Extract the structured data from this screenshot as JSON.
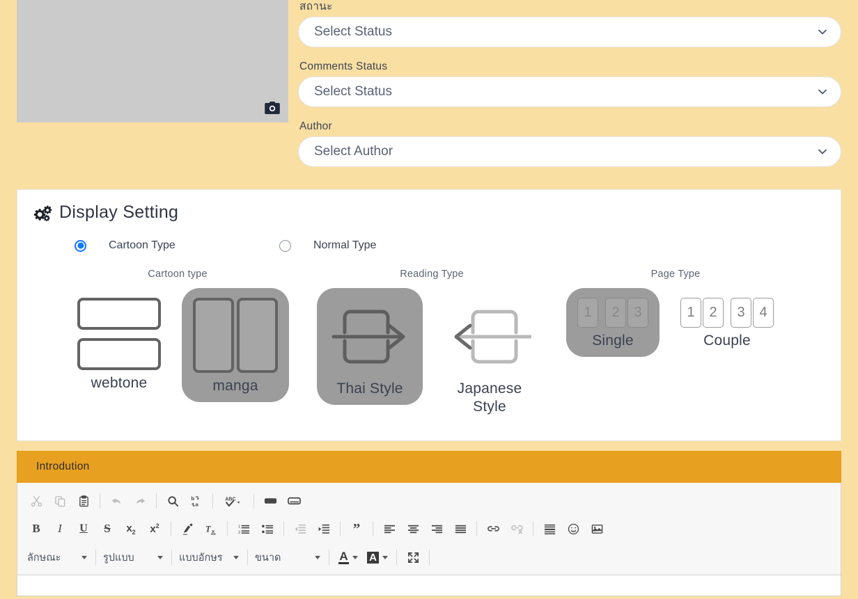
{
  "cover": {
    "camera_icon": "camera-icon",
    "alt": ""
  },
  "form": {
    "fields": [
      {
        "label": "สถานะ",
        "value": "Select Status",
        "name": "status"
      },
      {
        "label": "Comments Status",
        "value": "Select Status",
        "name": "comments-status"
      },
      {
        "label": "Author",
        "value": "Select Author",
        "name": "author"
      }
    ]
  },
  "display_setting": {
    "title": "Display Setting",
    "icon": "cogs-icon",
    "type_radios": [
      {
        "label": "Cartoon Type",
        "selected": true
      },
      {
        "label": "Normal Type",
        "selected": false
      }
    ],
    "groups": [
      {
        "title": "Cartoon type",
        "name": "cartoon-type",
        "options": [
          {
            "label": "webtone",
            "selected": false
          },
          {
            "label": "manga",
            "selected": true
          }
        ]
      },
      {
        "title": "Reading Type",
        "name": "reading-type",
        "options": [
          {
            "label": "Thai Style",
            "selected": true
          },
          {
            "label": "Japanese Style",
            "selected": false
          }
        ]
      },
      {
        "title": "Page Type",
        "name": "page-type",
        "options": [
          {
            "label": "Single",
            "selected": true,
            "pages": [
              "1",
              "2",
              "3"
            ]
          },
          {
            "label": "Couple",
            "selected": false,
            "pages": [
              "1",
              "2",
              "3",
              "4"
            ]
          }
        ]
      }
    ]
  },
  "introduction": {
    "header": "Introdution",
    "toolbar": {
      "row1": [
        {
          "name": "cut-icon",
          "disabled": true
        },
        {
          "name": "copy-icon",
          "disabled": true
        },
        {
          "name": "paste-icon",
          "disabled": false
        },
        {
          "name": "undo-icon",
          "disabled": true
        },
        {
          "name": "redo-icon",
          "disabled": true
        },
        {
          "name": "find-icon",
          "disabled": false
        },
        {
          "name": "replace-icon",
          "disabled": false
        },
        {
          "name": "spellcheck-icon",
          "disabled": false
        },
        {
          "name": "text-field-icon",
          "disabled": false
        },
        {
          "name": "textarea-icon",
          "disabled": false
        }
      ],
      "row2": [
        {
          "name": "bold-icon",
          "disabled": false
        },
        {
          "name": "italic-icon",
          "disabled": false
        },
        {
          "name": "underline-icon",
          "disabled": false
        },
        {
          "name": "strikethrough-icon",
          "disabled": false
        },
        {
          "name": "subscript-icon",
          "disabled": false
        },
        {
          "name": "superscript-icon",
          "disabled": false
        },
        {
          "name": "remove-format-icon",
          "disabled": false
        },
        {
          "name": "clear-formatting-icon",
          "disabled": false
        },
        {
          "name": "numbered-list-icon",
          "disabled": false
        },
        {
          "name": "bulleted-list-icon",
          "disabled": false
        },
        {
          "name": "outdent-icon",
          "disabled": true
        },
        {
          "name": "indent-icon",
          "disabled": false
        },
        {
          "name": "blockquote-icon",
          "disabled": false
        },
        {
          "name": "align-left-icon",
          "disabled": false
        },
        {
          "name": "align-center-icon",
          "disabled": false
        },
        {
          "name": "align-right-icon",
          "disabled": false
        },
        {
          "name": "align-justify-icon",
          "disabled": false
        },
        {
          "name": "link-icon",
          "disabled": false
        },
        {
          "name": "unlink-icon",
          "disabled": true
        },
        {
          "name": "horizontal-rule-icon",
          "disabled": false
        },
        {
          "name": "smiley-icon",
          "disabled": false
        },
        {
          "name": "image-icon",
          "disabled": false
        }
      ],
      "combos": [
        {
          "label": "ลักษณะ",
          "name": "styles-combo"
        },
        {
          "label": "รูปแบบ",
          "name": "format-combo"
        },
        {
          "label": "แบบอักษร",
          "name": "font-combo"
        },
        {
          "label": "ขนาด",
          "name": "size-combo"
        }
      ],
      "text_color": "A",
      "bg_color": "A",
      "maximize": "maximize-icon"
    }
  },
  "colors": {
    "page_bg": "#fadfa3",
    "header_orange": "#e8a020",
    "card_white": "#ffffff",
    "placeholder_gray": "#cbcbcb",
    "selected_gray": "#9c9c9c",
    "radio_blue": "#1479ff",
    "toolbar_bg": "#f7f7f7"
  }
}
